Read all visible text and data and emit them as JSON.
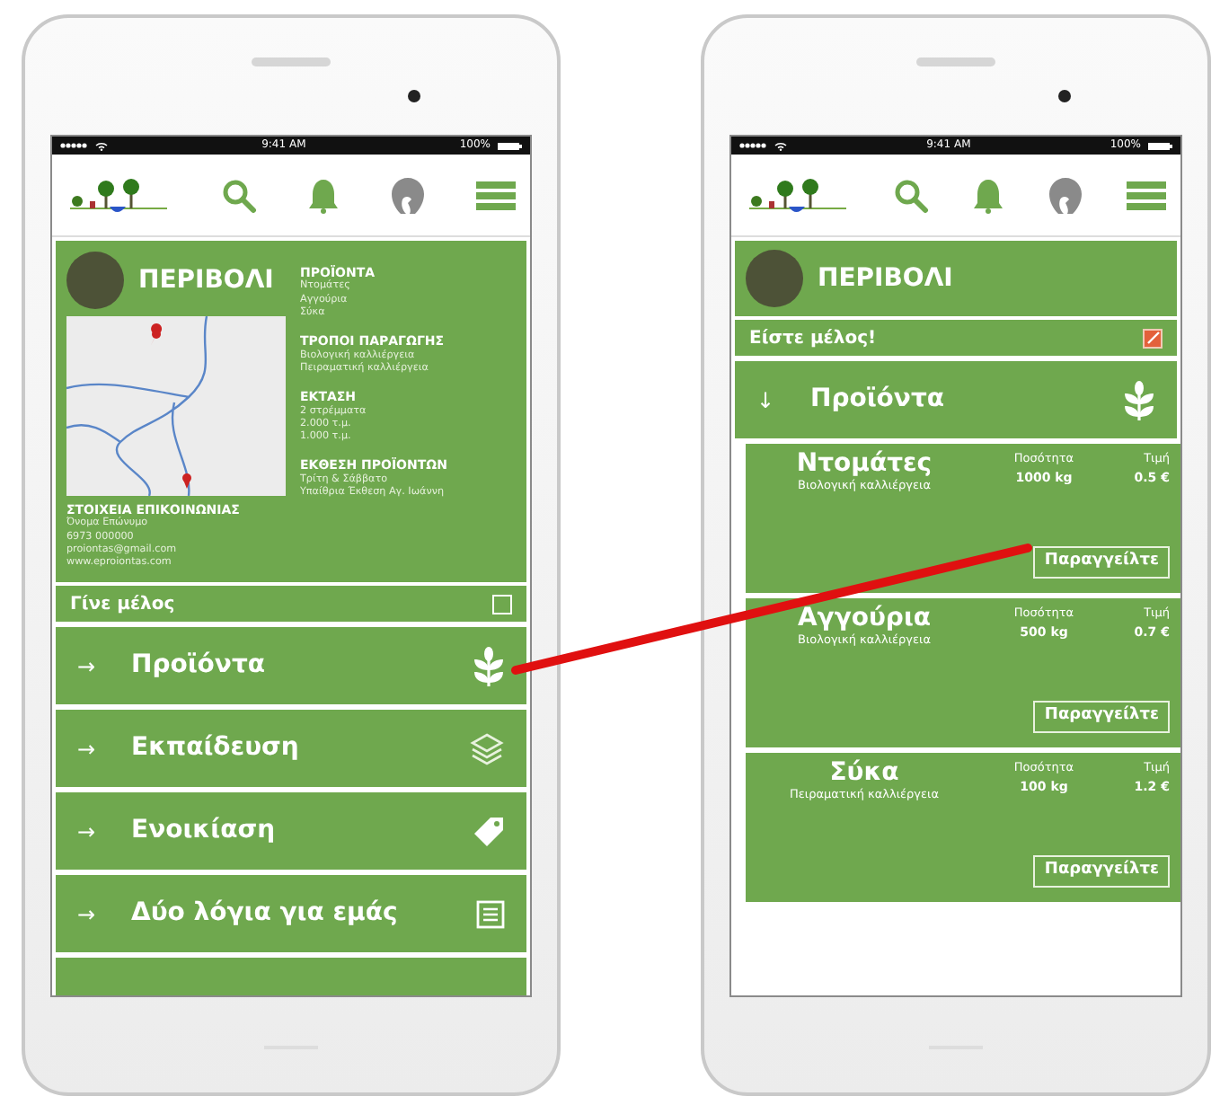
{
  "phones": [
    {
      "status_bar": {
        "time": "9:41 AM",
        "battery": "100%"
      },
      "farm": {
        "title": "ΠΕΡΙΒΟΛΙ",
        "sections": [
          {
            "heading": "ΠΡΟΪΟΝΤΑ",
            "lines": [
              "Ντομάτες",
              "Αγγούρια",
              "Σύκα"
            ]
          },
          {
            "heading": "ΤΡΟΠΟΙ ΠΑΡΑΓΩΓΗΣ",
            "lines": [
              "Βιολογική καλλιέργεια",
              "Πειραματική καλλιέργεια"
            ]
          },
          {
            "heading": "ΕΚΤΑΣΗ",
            "lines": [
              "2 στρέμματα",
              "2.000 τ.μ.",
              "1.000 τ.μ."
            ]
          },
          {
            "heading": "ΕΚΘΕΣΗ ΠΡΟΪΟΝΤΩΝ",
            "lines": [
              "Τρίτη & Σάββατο",
              "Υπαίθρια Έκθεση Αγ. Ιωάννη"
            ]
          }
        ],
        "contact": {
          "heading": "ΣΤΟΙΧΕΙΑ ΕΠΙΚΟΙΝΩΝΙΑΣ",
          "lines": [
            "Όνομα Επώνυμο",
            "6973 000000",
            "proiontas@gmail.com",
            "www.eproiontas.com"
          ]
        }
      },
      "membership": {
        "label": "Γίνε μέλος",
        "checked": false
      },
      "menu": [
        {
          "arrow": "→",
          "label": "Προϊόντα"
        },
        {
          "arrow": "→",
          "label": "Εκπαίδευση"
        },
        {
          "arrow": "→",
          "label": "Ενοικίαση"
        },
        {
          "arrow": "→",
          "label": "Δύο λόγια για εμάς"
        }
      ]
    },
    {
      "status_bar": {
        "time": "9:41 AM",
        "battery": "100%"
      },
      "farm": {
        "title": "ΠΕΡΙΒΟΛΙ"
      },
      "membership": {
        "label": "Είστε μέλος!",
        "checked": true
      },
      "menu": [
        {
          "arrow": "↓",
          "label": "Προϊόντα"
        }
      ],
      "products": [
        {
          "name": "Ντομάτες",
          "method": "Βιολογική καλλιέργεια",
          "quantity_label": "Ποσότητα",
          "quantity": "1000 kg",
          "price_label": "Τιμή",
          "price": "0.5 €",
          "button": "Παραγγείλτε"
        },
        {
          "name": "Αγγούρια",
          "method": "Βιολογική καλλιέργεια",
          "quantity_label": "Ποσότητα",
          "quantity": "500 kg",
          "price_label": "Τιμή",
          "price": "0.7 €",
          "button": "Παραγγείλτε"
        },
        {
          "name": "Σύκα",
          "method": "Πειραματική καλλιέργεια",
          "quantity_label": "Ποσότητα",
          "quantity": "100 kg",
          "price_label": "Τιμή",
          "price": "1.2 €",
          "button": "Παραγγείλτε"
        }
      ]
    }
  ]
}
